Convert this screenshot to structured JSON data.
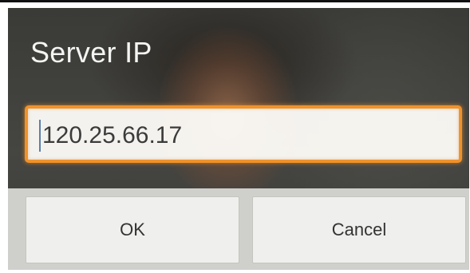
{
  "dialog": {
    "title": "Server IP",
    "input": {
      "value": "120.25.66.17",
      "focused": true
    },
    "buttons": {
      "ok_label": "OK",
      "cancel_label": "Cancel"
    }
  },
  "colors": {
    "dialog_background": "#3f3f3c",
    "focus_accent": "#f0922a",
    "button_background": "#efefed",
    "title_text": "#f4f4f2"
  }
}
